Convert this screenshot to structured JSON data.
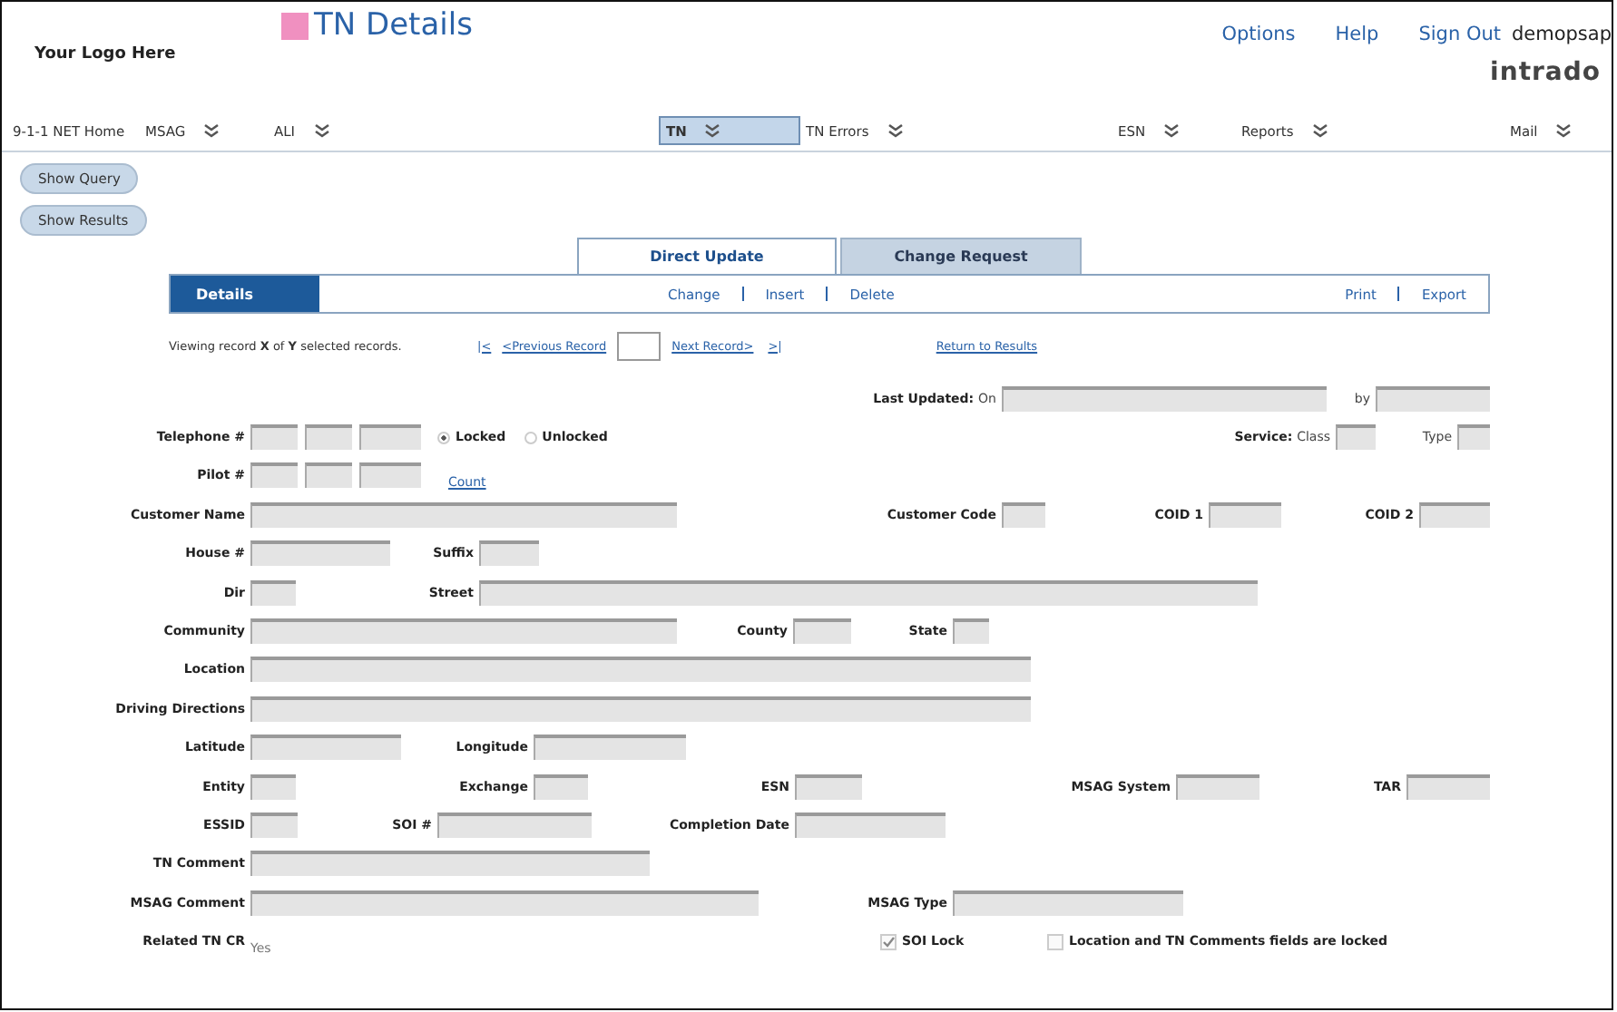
{
  "header": {
    "logo_placeholder": "Your Logo Here",
    "title": "TN Details",
    "links": [
      "Options",
      "Help",
      "Sign Out"
    ],
    "user": "demopsap",
    "brand": "intrado"
  },
  "nav": [
    {
      "label": "9-1-1 NET Home",
      "dropdown": false,
      "selected": false
    },
    {
      "label": "MSAG",
      "dropdown": true,
      "selected": false
    },
    {
      "label": "ALI",
      "dropdown": true,
      "selected": false
    },
    {
      "label": "TN",
      "dropdown": true,
      "selected": true
    },
    {
      "label": "TN Errors",
      "dropdown": true,
      "selected": false
    },
    {
      "label": "ESN",
      "dropdown": true,
      "selected": false
    },
    {
      "label": "Reports",
      "dropdown": true,
      "selected": false
    },
    {
      "label": "Mail",
      "dropdown": true,
      "selected": false
    }
  ],
  "side_buttons": [
    "Show Query",
    "Show Results"
  ],
  "tabs": [
    {
      "label": "Direct Update",
      "selected": true
    },
    {
      "label": "Change Request",
      "selected": false
    }
  ],
  "toolbar": {
    "title": "Details",
    "actions": [
      "Change",
      "Insert",
      "Delete"
    ],
    "output_actions": [
      "Print",
      "Export"
    ]
  },
  "record_nav": {
    "summary": "Viewing record **X** of **Y** selected records.",
    "first": "|<",
    "previous": "<Previous Record",
    "next": "Next Record>",
    "last": ">|",
    "return": "Return to Results"
  },
  "form_rows": [
    {
      "fields": [
        {
          "kind": "text",
          "label": "Last Updated:",
          "sublabel": "On"
        },
        {
          "kind": "text",
          "sublabel": "by"
        }
      ]
    },
    {
      "fields": [
        {
          "kind": "phone",
          "label": "Telephone #"
        },
        {
          "kind": "radio",
          "options": [
            {
              "label": "Locked",
              "selected": true
            },
            {
              "label": "Unlocked",
              "selected": false
            }
          ]
        },
        {
          "kind": "text",
          "label": "Service:",
          "sublabel": "Class"
        },
        {
          "kind": "text",
          "sublabel": "Type"
        }
      ]
    },
    {
      "fields": [
        {
          "kind": "phone",
          "label": "Pilot #"
        },
        {
          "kind": "link",
          "text": "Count"
        }
      ]
    },
    {
      "fields": [
        {
          "kind": "text",
          "label": "Customer Name"
        },
        {
          "kind": "text",
          "label": "Customer Code"
        },
        {
          "kind": "text",
          "label": "COID 1"
        },
        {
          "kind": "text",
          "label": "COID 2"
        }
      ]
    },
    {
      "fields": [
        {
          "kind": "text",
          "label": "House #"
        },
        {
          "kind": "text",
          "label": "Suffix"
        }
      ]
    },
    {
      "fields": [
        {
          "kind": "text",
          "label": "Dir"
        },
        {
          "kind": "text",
          "label": "Street"
        }
      ]
    },
    {
      "fields": [
        {
          "kind": "text",
          "label": "Community"
        },
        {
          "kind": "text",
          "label": "County"
        },
        {
          "kind": "text",
          "label": "State"
        }
      ]
    },
    {
      "fields": [
        {
          "kind": "text",
          "label": "Location"
        }
      ]
    },
    {
      "fields": [
        {
          "kind": "text",
          "label": "Driving Directions"
        }
      ]
    },
    {
      "fields": [
        {
          "kind": "text",
          "label": "Latitude"
        },
        {
          "kind": "text",
          "label": "Longitude"
        }
      ]
    },
    {
      "fields": [
        {
          "kind": "text",
          "label": "Entity"
        },
        {
          "kind": "text",
          "label": "Exchange"
        },
        {
          "kind": "text",
          "label": "ESN"
        },
        {
          "kind": "text",
          "label": "MSAG System"
        },
        {
          "kind": "text",
          "label": "TAR"
        }
      ]
    },
    {
      "fields": [
        {
          "kind": "text",
          "label": "ESSID"
        },
        {
          "kind": "text",
          "label": "SOI #"
        },
        {
          "kind": "text",
          "label": "Completion Date"
        }
      ]
    },
    {
      "fields": [
        {
          "kind": "text",
          "label": "TN Comment"
        }
      ]
    },
    {
      "fields": [
        {
          "kind": "text",
          "label": "MSAG Comment"
        },
        {
          "kind": "text",
          "label": "MSAG Type"
        }
      ]
    },
    {
      "fields": [
        {
          "kind": "value",
          "label": "Related TN CR",
          "value": "Yes"
        },
        {
          "kind": "checkbox",
          "label": "SOI Lock",
          "checked": true
        },
        {
          "kind": "checkbox",
          "label": "Location and TN Comments fields are locked",
          "checked": false
        }
      ]
    }
  ]
}
